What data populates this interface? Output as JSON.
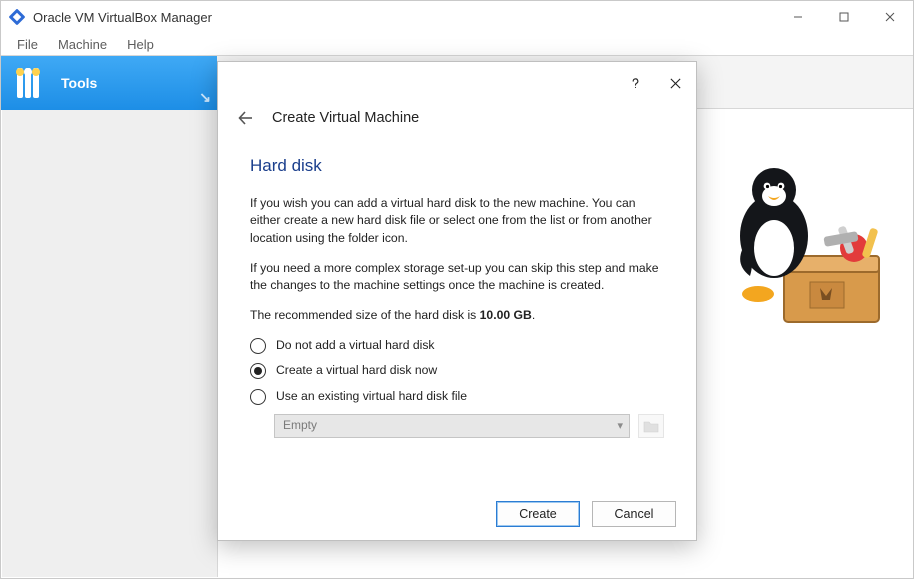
{
  "window": {
    "title": "Oracle VM VirtualBox Manager"
  },
  "menubar": {
    "file": "File",
    "machine": "Machine",
    "help": "Help"
  },
  "sidebar": {
    "tools_label": "Tools"
  },
  "dialog": {
    "title": "Create Virtual Machine",
    "heading": "Hard disk",
    "para1": "If you wish you can add a virtual hard disk to the new machine. You can either create a new hard disk file or select one from the list or from another location using the folder icon.",
    "para2": "If you need a more complex storage set-up you can skip this step and make the changes to the machine settings once the machine is created.",
    "reco_pre": "The recommended size of the hard disk is ",
    "reco_size": "10.00 GB",
    "reco_post": ".",
    "options": {
      "none": "Do not add a virtual hard disk",
      "create": "Create a virtual hard disk now",
      "existing": "Use an existing virtual hard disk file"
    },
    "combo_value": "Empty",
    "buttons": {
      "create": "Create",
      "cancel": "Cancel"
    }
  }
}
